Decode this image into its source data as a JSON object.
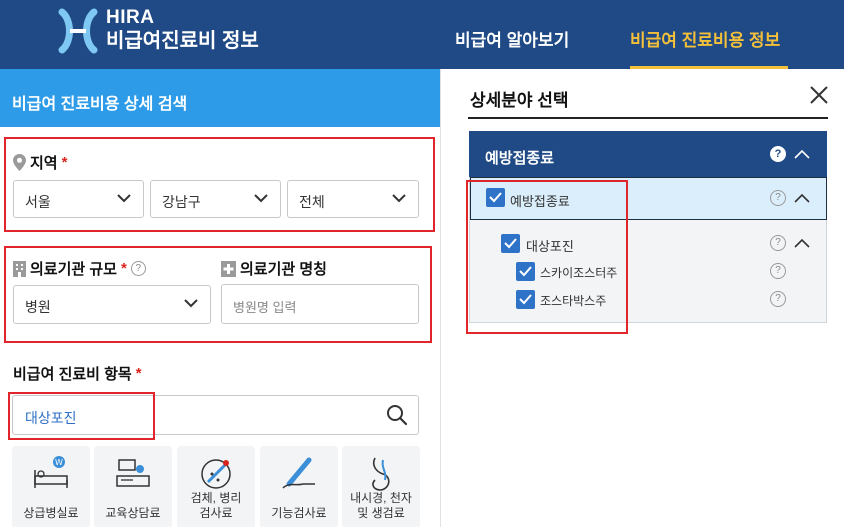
{
  "header": {
    "brand_line1": "HIRA",
    "brand_line2": "비급여진료비 정보",
    "nav": [
      "비급여 알아보기",
      "비급여 진료비용 정보"
    ],
    "active_nav_index": 1,
    "colors": {
      "header_bg": "#1f4a85",
      "active": "#f4c03a"
    }
  },
  "left": {
    "title": "비급여 진료비용 상세 검색",
    "region": {
      "label": "지역",
      "required": "*",
      "selects": [
        "서울",
        "강남구",
        "전체"
      ]
    },
    "institution_scale": {
      "label": "의료기관 규모",
      "required": "*",
      "help": "?",
      "value": "병원"
    },
    "institution_name": {
      "label": "의료기관 명칭",
      "placeholder": "병원명 입력"
    },
    "item": {
      "label": "비급여 진료비 항목",
      "required": "*",
      "value": "대상포진"
    },
    "categories": [
      {
        "label": "상급병실료",
        "icon": "hospital-bed-icon"
      },
      {
        "label": "교육상담료",
        "icon": "consultation-icon"
      },
      {
        "label": "검체, 병리\n검사료",
        "icon": "microscope-icon"
      },
      {
        "label": "기능검사료",
        "icon": "thermometer-icon"
      },
      {
        "label": "내시경, 천자\n및 생검료",
        "icon": "endoscope-icon"
      }
    ]
  },
  "right": {
    "title": "상세분야 선택",
    "tree_head": "예방접종료",
    "tree_help": "?",
    "rows": [
      {
        "label": "예방접종료",
        "checked": true,
        "help": "?"
      },
      {
        "label": "대상포진",
        "checked": true,
        "help": "?"
      },
      {
        "label": "스카이조스터주",
        "checked": true,
        "help": "?"
      },
      {
        "label": "조스타박스주",
        "checked": true,
        "help": "?"
      }
    ]
  }
}
